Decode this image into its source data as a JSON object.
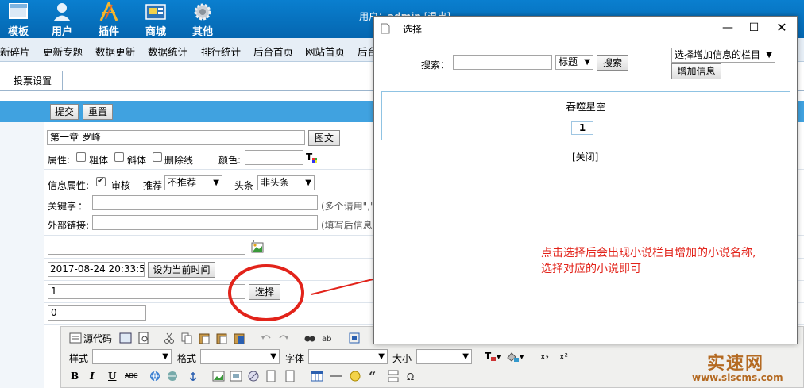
{
  "topnav": [
    {
      "label": "模板",
      "icon": "template-icon"
    },
    {
      "label": "用户",
      "icon": "user-icon"
    },
    {
      "label": "插件",
      "icon": "plugin-icon"
    },
    {
      "label": "商城",
      "icon": "shop-icon"
    },
    {
      "label": "其他",
      "icon": "gear-icon"
    }
  ],
  "user": {
    "prefix": "用户：",
    "name": "admin",
    "logout": "[退出]"
  },
  "menu": [
    "新碎片",
    "更新专题",
    "数据更新",
    "数据统计",
    "排行统计",
    "后台首页",
    "网站首页",
    "后台"
  ],
  "tab": {
    "label": "投票设置"
  },
  "actions": {
    "submit": "提交",
    "reset": "重置"
  },
  "form": {
    "title_value": "第一章 罗峰",
    "title_button": "图文",
    "attr_label": "属性:",
    "attr_bold": "粗体",
    "attr_italic": "斜体",
    "attr_strike": "删除线",
    "color_label": "颜色:",
    "info_label": "信息属性:",
    "info_review": "审核",
    "recommend_label": "推荐",
    "recommend_value": "不推荐",
    "headline_label": "头条",
    "headline_value": "非头条",
    "keywords_label": "关键字",
    "keywords_colon": "：",
    "keywords_hint": "(多个请用\",\"",
    "link_label": "外部链接:",
    "link_hint": "(填写后信息",
    "datetime_value": "2017-08-24 20:33:56",
    "datetime_button": "设为当前时间",
    "class_value": "1",
    "select_button": "选择",
    "number_value": "0"
  },
  "editor": {
    "source_label": "源代码",
    "style_label": "样式",
    "format_label": "格式",
    "font_label": "字体",
    "size_label": "大小",
    "bold": "B",
    "italic": "I",
    "underline": "U",
    "strike": "ABC",
    "subscript": "x₂",
    "superscript": "x²"
  },
  "dialog": {
    "title": "选择",
    "search_label": "搜索：",
    "search_value": "",
    "field_select": "标题",
    "search_button": "搜索",
    "category_select": "选择增加信息的栏目",
    "add_button": "增加信息",
    "result_title": "吞噬星空",
    "page": "1",
    "close_link": "[关闭]"
  },
  "annotation": {
    "line1": "点击选择后会出现小说栏目增加的小说名称,",
    "line2": "选择对应的小说即可"
  },
  "watermark": {
    "brand": "实速网",
    "url": "www.siscms.com"
  },
  "colors": {
    "topbar": "#0a7fcf",
    "bluebar": "#40a2e0",
    "annotation": "#e2231a",
    "watermark": "#b46a22"
  }
}
